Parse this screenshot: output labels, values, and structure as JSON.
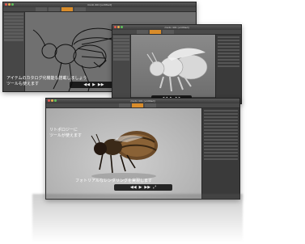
{
  "windows": {
    "back": {
      "title": "modo 401 [untitled]",
      "caption_line1": "アイテムのカタログ化機能も搭載しましょう",
      "caption_line2": "ツールも使えます"
    },
    "middle": {
      "title": "modo 401 [untitled]"
    },
    "front": {
      "title": "modo 401 [untitled]",
      "caption_left_line1": "リトポロジーに",
      "caption_left_line2": "ツールが使えます",
      "caption_bottom": "フォトリアルなレンダリングを実現します"
    }
  },
  "player": {
    "prev": "◀◀",
    "play": "▶",
    "next": "▶▶",
    "fullscreen": "⤢"
  },
  "colors": {
    "ui_dark": "#3d3d3d",
    "viewport_gray": "#6d6d6d",
    "accent_orange": "#d98c2a",
    "photo_ground": "#bcbcbc"
  }
}
